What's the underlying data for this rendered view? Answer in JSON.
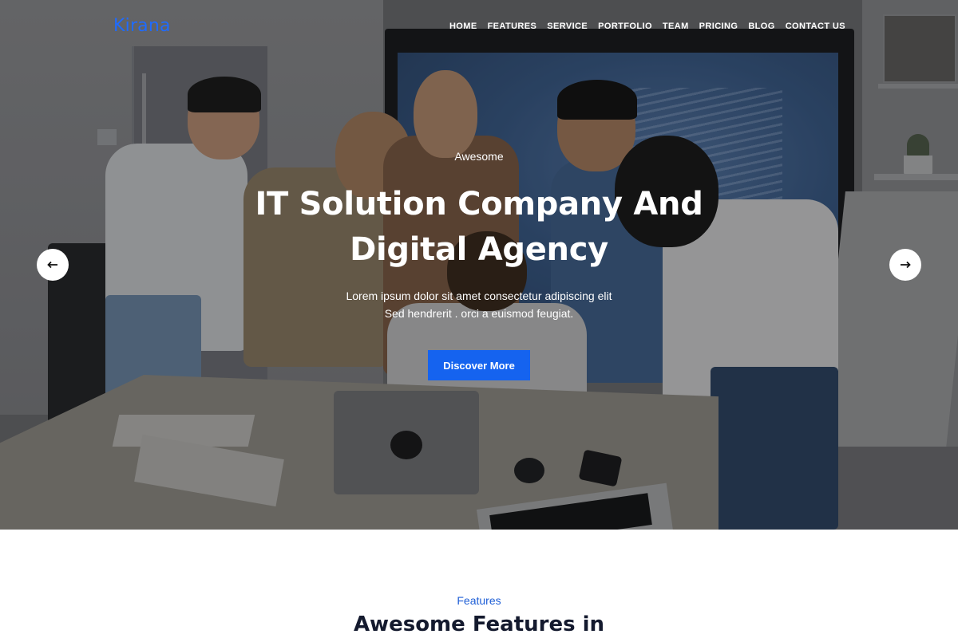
{
  "header": {
    "logo": "Kirana",
    "nav": [
      "HOME",
      "FEATURES",
      "SERVICE",
      "PORTFOLIO",
      "TEAM",
      "PRICING",
      "BLOG",
      "CONTACT US"
    ]
  },
  "hero": {
    "eyebrow": "Awesome",
    "headline_line1": "IT Solution Company And",
    "headline_line2": "Digital Agency",
    "subtext_line1": "Lorem ipsum dolor sit amet consectetur adipiscing elit",
    "subtext_line2": "Sed hendrerit . orci a euismod feugiat.",
    "cta_label": "Discover More",
    "prev_icon": "arrow-left-icon",
    "next_icon": "arrow-right-icon"
  },
  "features": {
    "label": "Features",
    "title": "Awesome Features in"
  },
  "colors": {
    "brand": "#1f6bff",
    "cta": "#1563ef",
    "features_label": "#1f5fd6",
    "heading_dark": "#141a2e"
  }
}
